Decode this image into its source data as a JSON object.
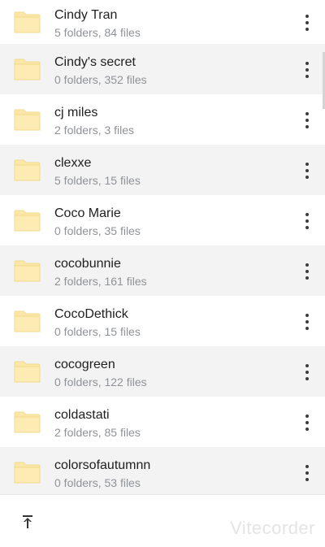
{
  "folders": [
    {
      "name": "Cindy Tran",
      "info": "5 folders, 84 files"
    },
    {
      "name": "Cindy's secret",
      "info": "0 folders, 352 files"
    },
    {
      "name": "cj miles",
      "info": "2 folders, 3 files"
    },
    {
      "name": "clexxe",
      "info": "5 folders, 15 files"
    },
    {
      "name": "Coco Marie",
      "info": "0 folders, 35 files"
    },
    {
      "name": "cocobunnie",
      "info": "2 folders, 161 files"
    },
    {
      "name": "CocoDethick",
      "info": "0 folders, 15 files"
    },
    {
      "name": "cocogreen",
      "info": "0 folders, 122 files"
    },
    {
      "name": "coldastati",
      "info": "2 folders, 85 files"
    },
    {
      "name": "colorsofautumnn",
      "info": "0 folders, 53 files"
    }
  ],
  "icons": {
    "folder": "folder-icon",
    "more": "more-vert-icon",
    "scroll_top": "scroll-to-top-icon"
  },
  "colors": {
    "folder": "#fbe7a8",
    "row_alt": "#f3f3f4",
    "subtext": "#8f9296"
  },
  "watermark": "Vitecorder"
}
